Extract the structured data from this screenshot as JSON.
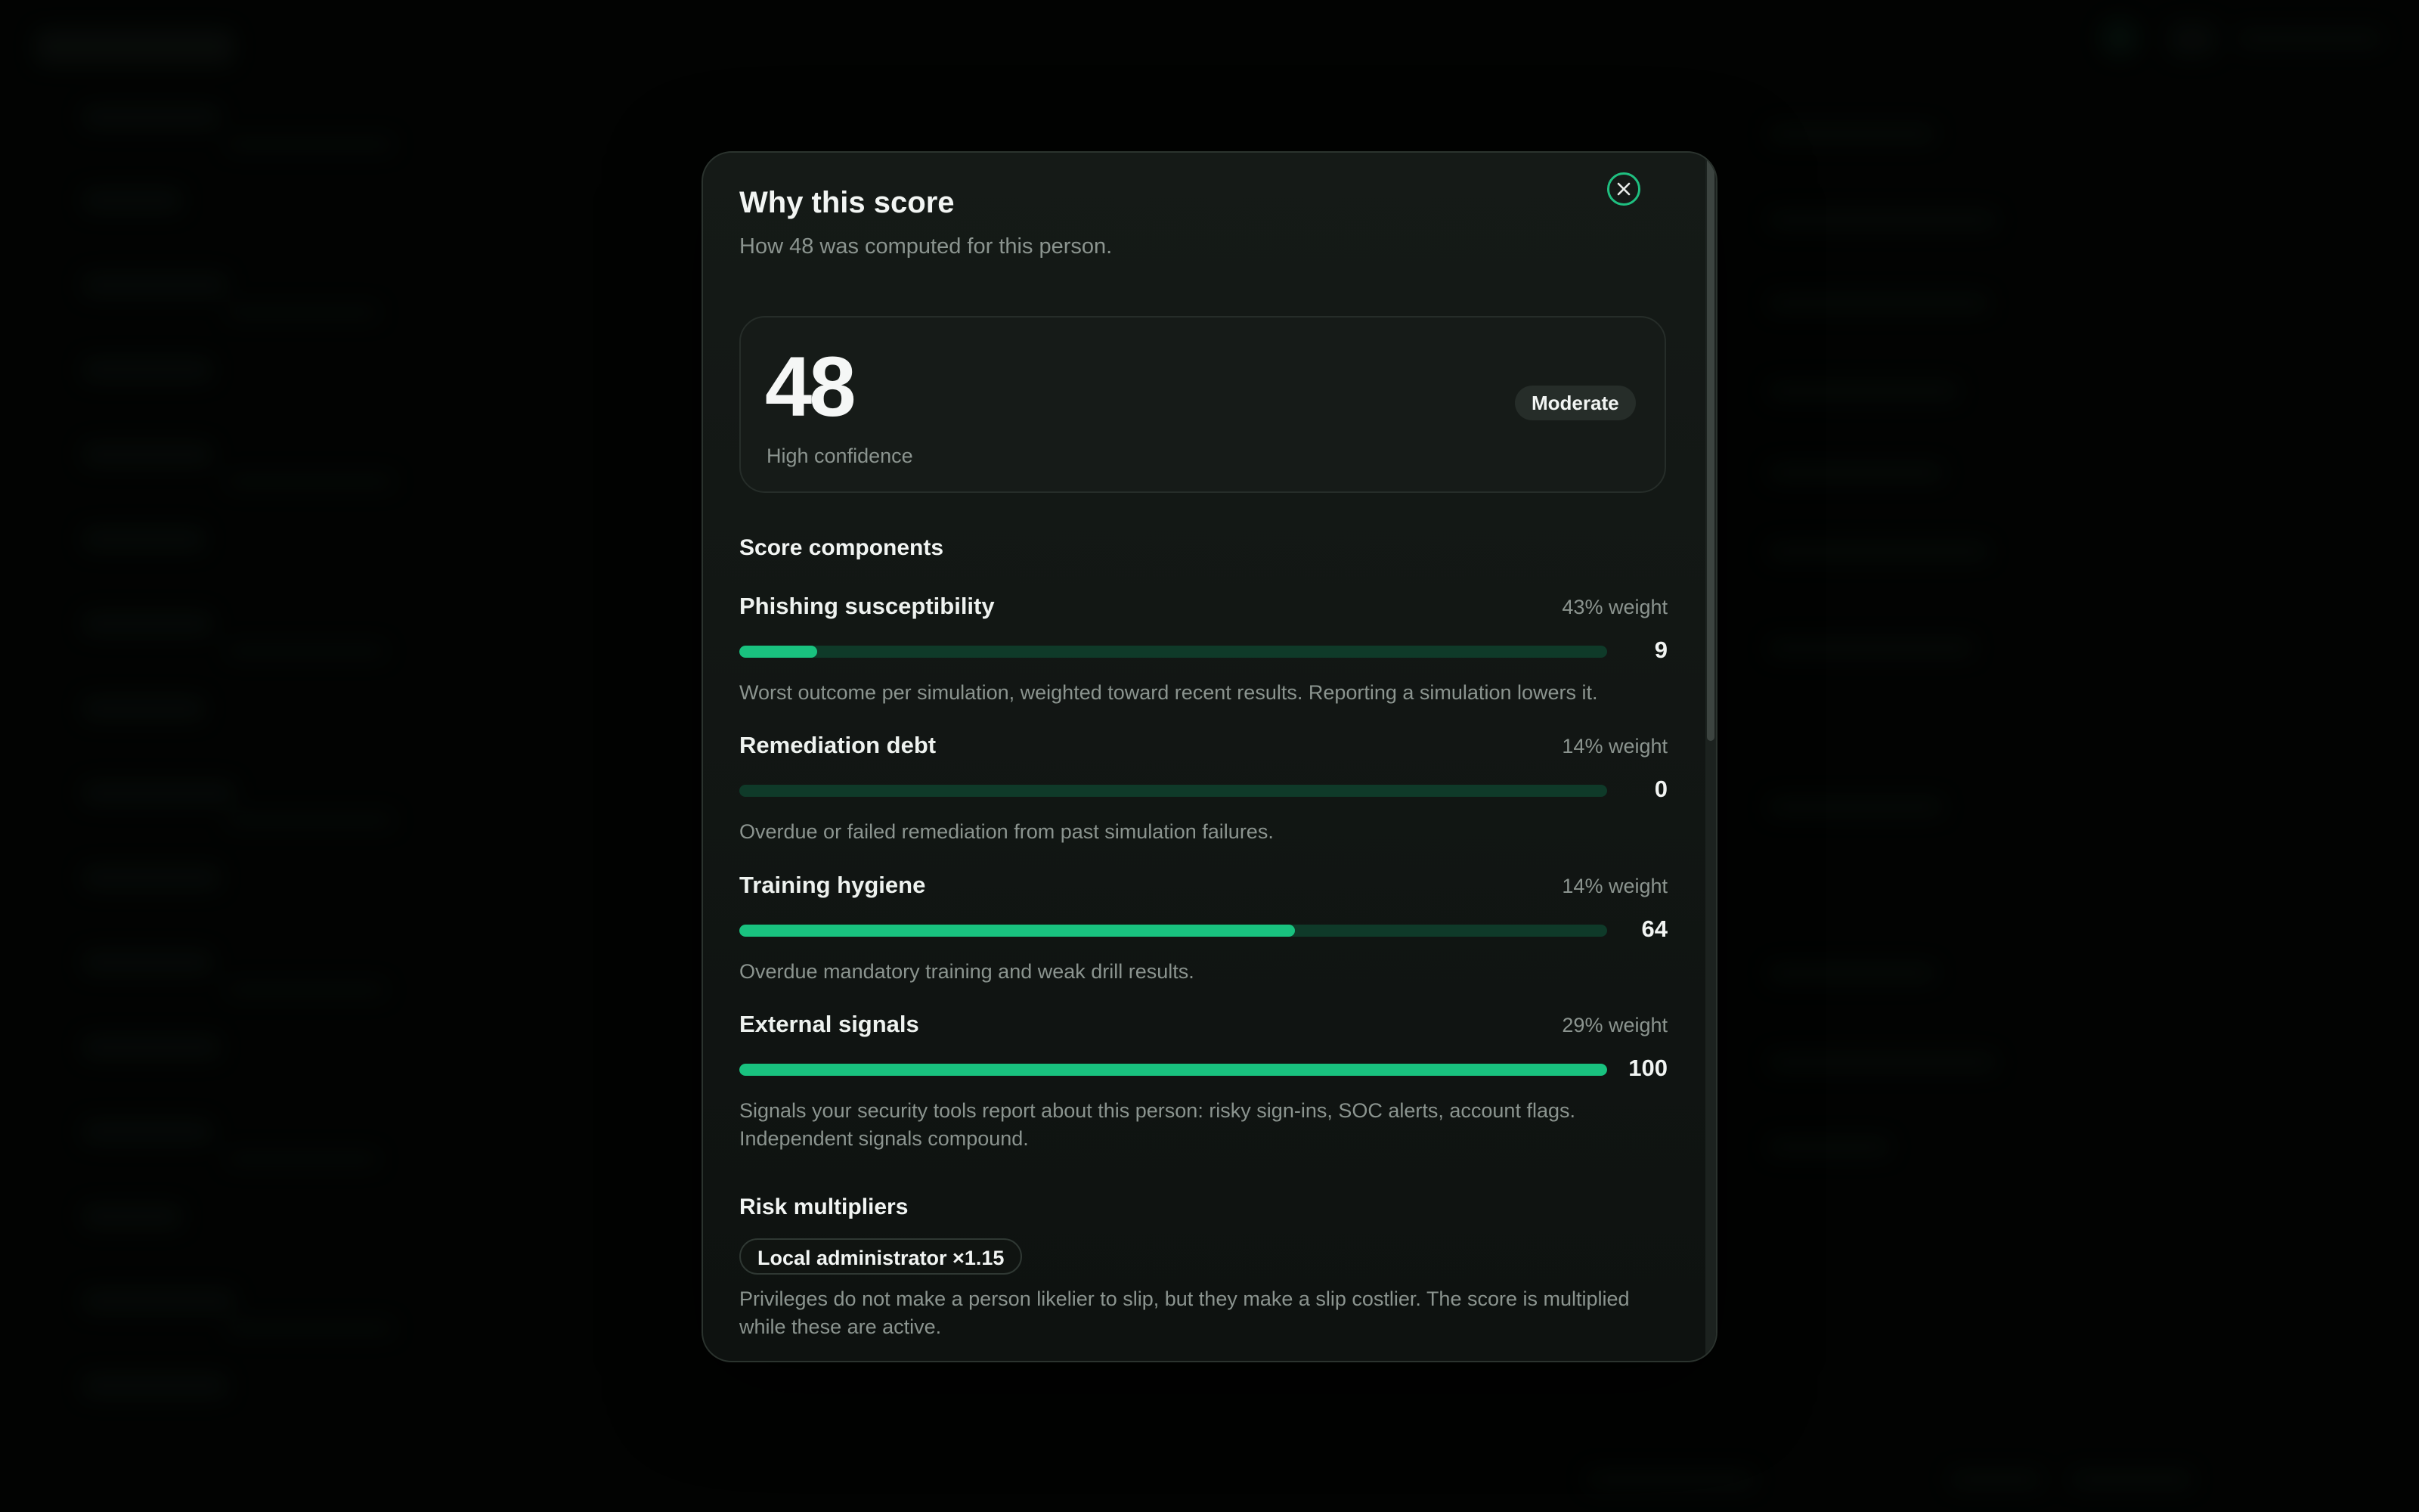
{
  "modal": {
    "title": "Why this score",
    "subtitle": "How 48 was computed for this person.",
    "close_icon": "close-icon"
  },
  "score": {
    "value": "48",
    "confidence": "High confidence",
    "level": "Moderate"
  },
  "components": {
    "title": "Score components",
    "items": [
      {
        "name": "Phishing susceptibility",
        "weight": "43% weight",
        "score": "9",
        "fraction": 0.09,
        "description": "Worst outcome per simulation, weighted toward recent results. Reporting a simulation lowers it."
      },
      {
        "name": "Remediation debt",
        "weight": "14% weight",
        "score": "0",
        "fraction": 0,
        "description": "Overdue or failed remediation from past simulation failures."
      },
      {
        "name": "Training hygiene",
        "weight": "14% weight",
        "score": "64",
        "fraction": 0.64,
        "description": "Overdue mandatory training and weak drill results."
      },
      {
        "name": "External signals",
        "weight": "29% weight",
        "score": "100",
        "fraction": 1.0,
        "description": "Signals your security tools report about this person: risky sign-ins, SOC alerts, account flags. Independent signals compound."
      }
    ]
  },
  "multipliers": {
    "title": "Risk multipliers",
    "chip": "Local administrator ×1.15",
    "description": "Privileges do not make a person likelier to slip, but they make a slip costlier. The score is multiplied while these are active."
  },
  "colors": {
    "accent": "#19c27f",
    "track": "#0f3a29",
    "panel": "#151a17"
  }
}
